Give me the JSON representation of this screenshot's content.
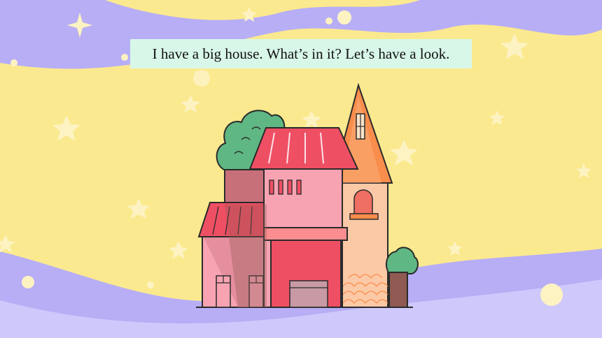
{
  "slide": {
    "caption": "I have a big house. What’s in it? Let’s have a look.",
    "colors": {
      "background": "#fbe98f",
      "wave": "#b7aef6",
      "caption_bg": "#d8f7e8",
      "roof_red": "#ef4f63",
      "wall_pink": "#f7a3b2",
      "wall_peach": "#fcc9a6",
      "roof_orange": "#f98d4b",
      "bush_green": "#5fb783"
    }
  }
}
